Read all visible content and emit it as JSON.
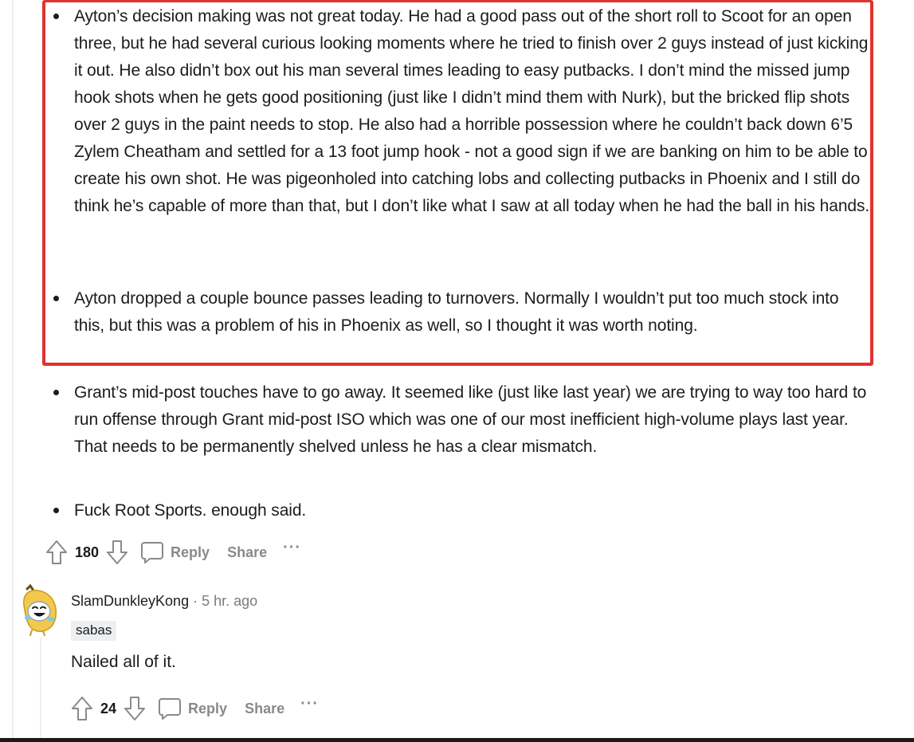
{
  "comment": {
    "bullets": [
      "Ayton’s decision making was not great today. He had a good pass out of the short roll to Scoot for an open three, but he had several curious looking moments where he tried to finish over 2 guys instead of just kicking it out. He also didn’t box out his man several times leading to easy putbacks. I don’t mind the missed jump hook shots when he gets good positioning (just like I didn’t mind them with Nurk), but the bricked flip shots over 2 guys in the paint needs to stop. He also had a horrible possession where he couldn’t back down 6’5 Zylem Cheatham and settled for a 13 foot jump hook - not a good sign if we are banking on him to be able to create his own shot. He was pigeonholed into catching lobs and collecting putbacks in Phoenix and I still do think he’s capable of more than that, but I don’t like what I saw at all today when he had the ball in his hands.",
      "Ayton dropped a couple bounce passes leading to turnovers. Normally I wouldn’t put too much stock into this, but this was a problem of his in Phoenix as well, so I thought it was worth noting.",
      "Grant’s mid-post touches have to go away. It seemed like (just like last year) we are trying to way too hard to run offense through Grant mid-post ISO which was one of our most inefficient high-volume plays last year. That needs to be permanently shelved unless he has a clear mismatch.",
      "Fuck Root Sports. enough said."
    ],
    "actions": {
      "votes": "180",
      "reply_label": "Reply",
      "share_label": "Share",
      "more_label": "···"
    }
  },
  "reply": {
    "username": "SlamDunkleyKong",
    "separator": "·",
    "timestamp": "5 hr. ago",
    "flair": "sabas",
    "body": "Nailed all of it.",
    "actions": {
      "votes": "24",
      "reply_label": "Reply",
      "share_label": "Share",
      "more_label": "···"
    }
  },
  "colors": {
    "highlight": "#e0332f",
    "meta_gray": "#878a8c",
    "text": "#1c1c1c",
    "flair_bg": "#edeff1"
  },
  "icons": [
    "upvote-icon",
    "downvote-icon",
    "comment-bubble-icon",
    "more-dots-icon",
    "avatar-snoo-banana"
  ]
}
